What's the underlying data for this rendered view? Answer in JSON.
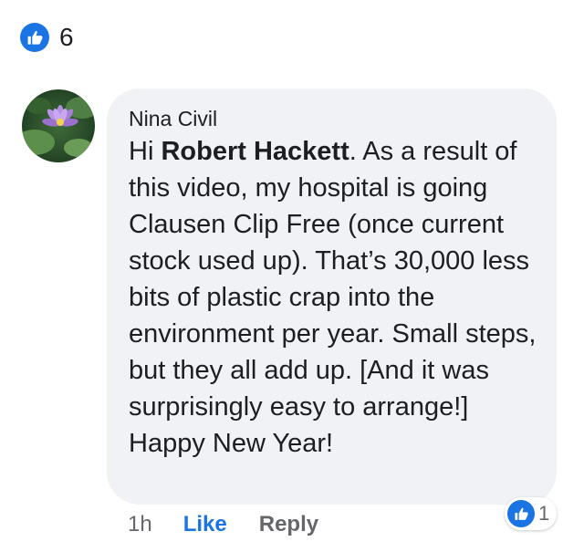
{
  "reactions_summary": {
    "icon": "like-icon",
    "count": "6",
    "color": "#1b74e4"
  },
  "comment": {
    "author": "Nina Civil",
    "text_before_mention": "Hi ",
    "mention": "Robert Hackett",
    "text_after_mention": ". As a result of this video, my hospital is going Clausen Clip Free (once current stock used up).  That’s 30,000 less bits of plastic crap into the environment per year. Small steps, but they all add up. [And it was surprisingly easy to arrange!] Happy New Year!",
    "reaction_icon": "like-icon",
    "reaction_count": "1",
    "bubble_color": "#f0f2f5"
  },
  "actions": {
    "timestamp": "1h",
    "like_label": "Like",
    "reply_label": "Reply"
  }
}
